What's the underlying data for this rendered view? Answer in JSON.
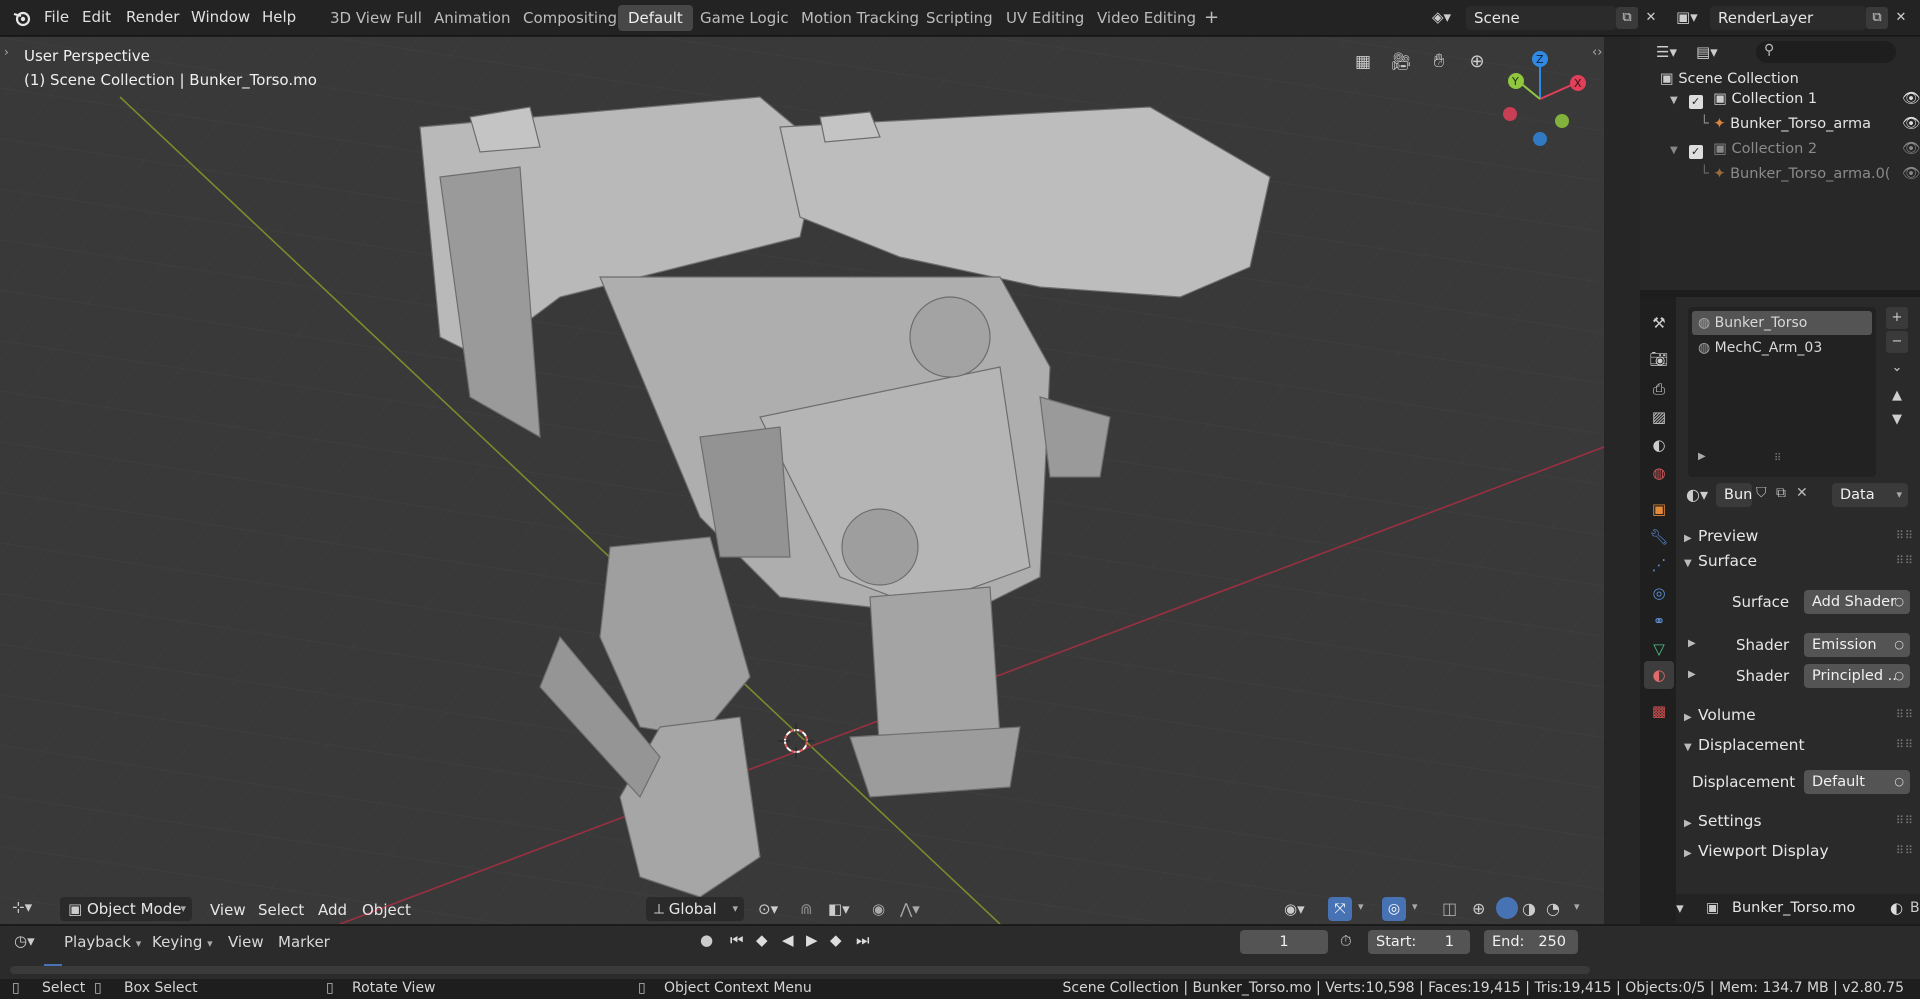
{
  "menu": {
    "items": [
      "File",
      "Edit",
      "Render",
      "Window",
      "Help"
    ]
  },
  "workspaces": {
    "tabs": [
      "3D View Full",
      "Animation",
      "Compositing",
      "Default",
      "Game Logic",
      "Motion Tracking",
      "Scripting",
      "UV Editing",
      "Video Editing"
    ],
    "active": "Default",
    "add_label": "+"
  },
  "scene_selector": {
    "value": "Scene"
  },
  "renderlayer_selector": {
    "value": "RenderLayer"
  },
  "viewport": {
    "perspective_label": "User Perspective",
    "collection_label": "(1) Scene Collection | Bunker_Torso.mo",
    "gizmo_axes": {
      "x": "X",
      "y": "Y",
      "z": "Z"
    },
    "header": {
      "mode": "Object Mode",
      "menus": [
        "View",
        "Select",
        "Add",
        "Object"
      ],
      "transform_orientation": "Global"
    }
  },
  "outliner": {
    "search_placeholder": "",
    "root": "Scene Collection",
    "rows": [
      {
        "label": "Collection 1",
        "checked": true
      },
      {
        "label": "Bunker_Torso_arma"
      },
      {
        "label": "Collection 2",
        "checked": true
      },
      {
        "label": "Bunker_Torso_arma.0("
      }
    ]
  },
  "properties": {
    "material_slots": [
      "Bunker_Torso",
      "MechC_Arm_03"
    ],
    "material_name": "Bun",
    "data_dropdown": "Data",
    "sections": {
      "preview": "Preview",
      "surface": "Surface",
      "volume": "Volume",
      "displacement": "Displacement",
      "settings": "Settings",
      "viewport_display": "Viewport Display"
    },
    "surface_label": "Surface",
    "surface_value": "Add Shader",
    "shader1_label": "Shader",
    "shader1_value": "Emission",
    "shader2_label": "Shader",
    "shader2_value": "Principled ..",
    "displacement_label": "Displacement",
    "displacement_value": "Default"
  },
  "timeline": {
    "menus": [
      "Playback",
      "Keying",
      "View",
      "Marker"
    ],
    "current_frame": "1",
    "start_label": "Start:",
    "start_value": "1",
    "end_label": "End:",
    "end_value": "250"
  },
  "props_footer": {
    "object_name": "Bunker_Torso.mo",
    "trailing": "B"
  },
  "statusbar": {
    "select": "Select",
    "box_select": "Box Select",
    "rotate_view": "Rotate View",
    "context_menu": "Object Context Menu",
    "stats": "Scene Collection | Bunker_Torso.mo | Verts:10,598 | Faces:19,415 | Tris:19,415 | Objects:0/5 | Mem: 134.7 MB | v2.80.75"
  },
  "colors": {
    "accent_blue": "#4772b3",
    "axis_x": "#e0405a",
    "axis_y": "#8fc73e",
    "axis_z": "#2f8ae6",
    "viewport_bg": "#393939"
  }
}
